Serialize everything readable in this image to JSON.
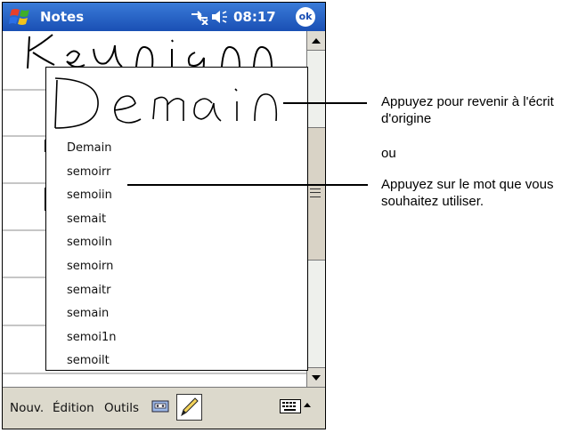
{
  "titlebar": {
    "app_title": "Notes",
    "time": "08:17",
    "ok_label": "ok"
  },
  "popup": {
    "alternates": [
      "Demain",
      "semoirr",
      "semoiin",
      "semait",
      "semoiln",
      "semoirn",
      "semaitr",
      "semain",
      "semoi1n",
      "semoilt"
    ]
  },
  "menubar": {
    "new_label": "Nouv.",
    "edit_label": "Édition",
    "tools_label": "Outils"
  },
  "callouts": {
    "top_text": "Appuyez pour revenir à l'écrit d'origine",
    "or_text": "ou",
    "bottom_text": "Appuyez sur le mot que vous souhaitez utiliser."
  },
  "icons": {
    "start": "windows-flag-icon",
    "connectivity": "connectivity-icon",
    "volume": "speaker-icon",
    "ok": "ok-icon",
    "tape": "cassette-icon",
    "pen": "pen-icon",
    "keyboard": "keyboard-icon",
    "sip_arrow": "arrow-up-icon",
    "scroll_up": "arrow-up-icon",
    "scroll_down": "arrow-down-icon"
  },
  "colors": {
    "titlebar": "#1a4fb4",
    "menubar": "#dcd9cc"
  }
}
